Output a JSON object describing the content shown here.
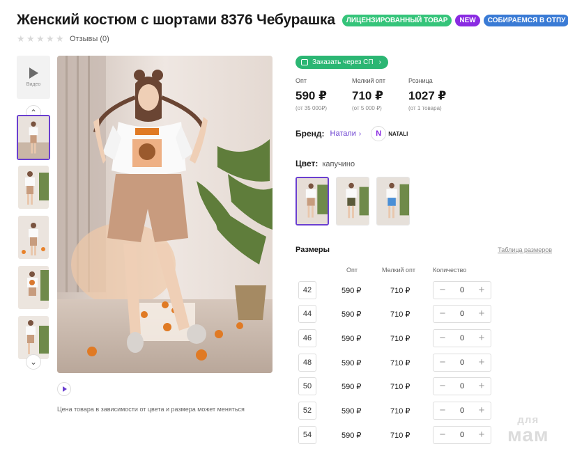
{
  "product": {
    "title": "Женский костюм с шортами 8376 Чебурашка",
    "badges": [
      "ЛИЦЕНЗИРОВАННЫЙ ТОВАР",
      "NEW",
      "СОБИРАЕМСЯ В ОТПУ"
    ],
    "rating": 0,
    "reviews_label": "Отзывы (0)"
  },
  "gallery": {
    "video_label": "Видео",
    "note": "Цена товара в зависимости от цвета и размера может меняться"
  },
  "order_button": {
    "label": "Заказать через СП"
  },
  "prices": [
    {
      "label": "Опт",
      "value": "590 ₽",
      "condition": "(от 35 000₽)"
    },
    {
      "label": "Мелкий опт",
      "value": "710 ₽",
      "condition": "(от 5 000 ₽)"
    },
    {
      "label": "Розница",
      "value": "1027 ₽",
      "condition": "(от 1 товара)"
    }
  ],
  "brand": {
    "label": "Бренд:",
    "name": "Натали",
    "logo_text": "NATALI"
  },
  "color": {
    "label": "Цвет:",
    "value": "капучино"
  },
  "sizes": {
    "title": "Размеры",
    "table_link": "Таблица размеров",
    "columns": {
      "opt": "Опт",
      "small_opt": "Мелкий опт",
      "quantity": "Количество"
    },
    "rows": [
      {
        "size": "42",
        "opt": "590 ₽",
        "small_opt": "710 ₽",
        "qty": "0"
      },
      {
        "size": "44",
        "opt": "590 ₽",
        "small_opt": "710 ₽",
        "qty": "0"
      },
      {
        "size": "46",
        "opt": "590 ₽",
        "small_opt": "710 ₽",
        "qty": "0"
      },
      {
        "size": "48",
        "opt": "590 ₽",
        "small_opt": "710 ₽",
        "qty": "0"
      },
      {
        "size": "50",
        "opt": "590 ₽",
        "small_opt": "710 ₽",
        "qty": "0"
      },
      {
        "size": "52",
        "opt": "590 ₽",
        "small_opt": "710 ₽",
        "qty": "0"
      },
      {
        "size": "54",
        "opt": "590 ₽",
        "small_opt": "710 ₽",
        "qty": "0"
      }
    ]
  },
  "watermark": {
    "line1": "для",
    "line2": "мам"
  },
  "colors": {
    "accent": "#6a3fd0",
    "green": "#2bb673",
    "licensed_badge": "#35c47a",
    "new_badge": "#8a2be2",
    "vacation_badge": "#3a7bd5"
  }
}
